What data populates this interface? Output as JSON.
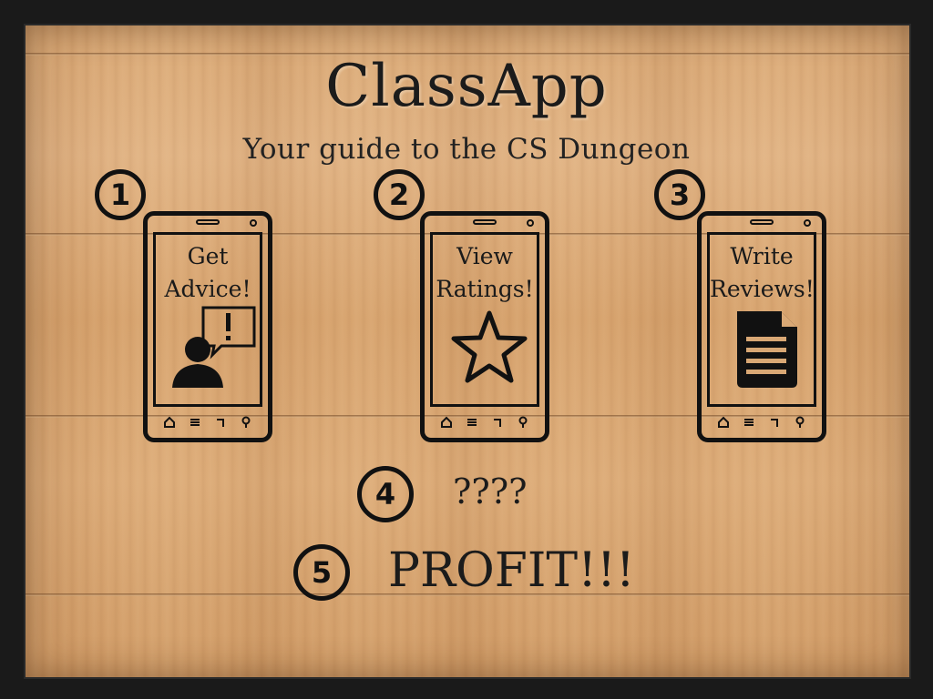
{
  "header": {
    "title": "ClassApp",
    "subtitle": "Your guide to the CS Dungeon"
  },
  "steps": [
    {
      "number": "1",
      "label": "Get\nAdvice!",
      "icon": "person-advice-icon"
    },
    {
      "number": "2",
      "label": "View\nRatings!",
      "icon": "star-icon"
    },
    {
      "number": "3",
      "label": "Write\nReviews!",
      "icon": "document-icon"
    }
  ],
  "extra_steps": [
    {
      "number": "4",
      "text": "????"
    },
    {
      "number": "5",
      "text": "PROFIT!!!"
    }
  ],
  "phone_nav_icons": [
    "home-icon",
    "menu-icon",
    "back-icon",
    "search-icon"
  ]
}
